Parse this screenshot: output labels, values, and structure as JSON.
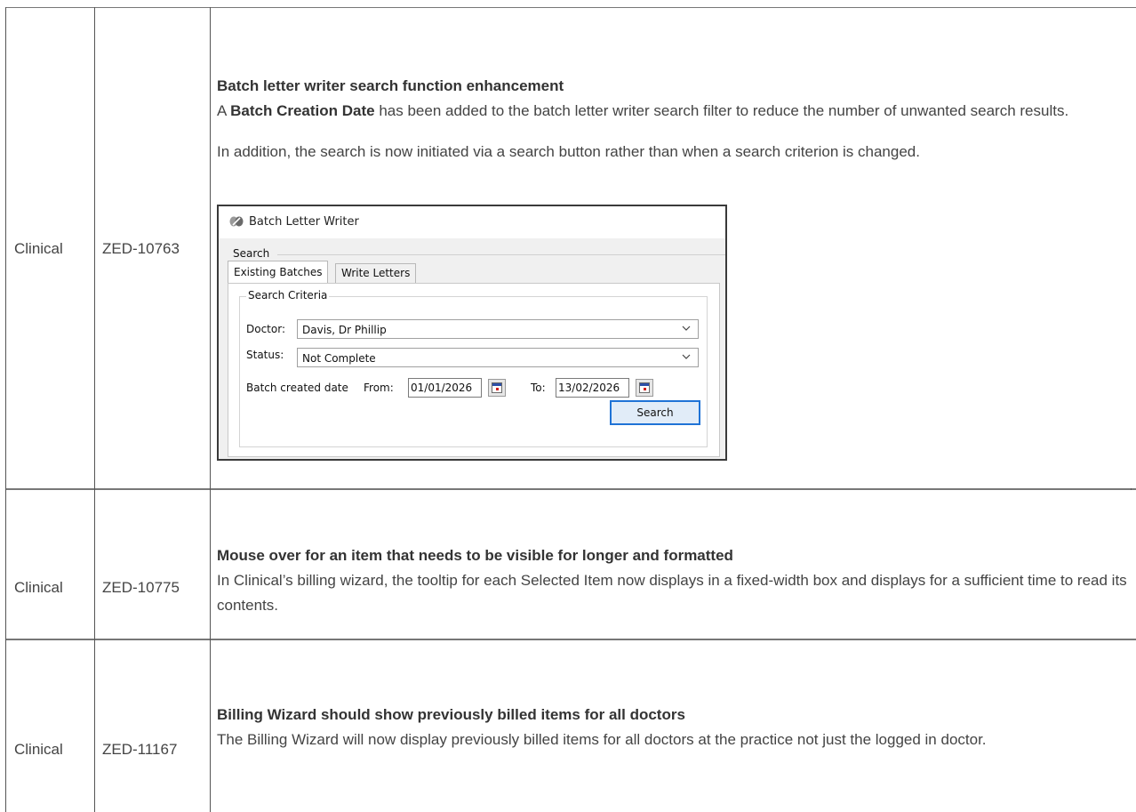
{
  "rows": [
    {
      "category": "Clinical",
      "ticket": "ZED-10763",
      "title": "Batch letter writer search function enhancement",
      "desc_pre": "A ",
      "desc_bold": "Batch Creation Date",
      "desc_post": " has been added to the batch letter writer search filter to reduce the number of unwanted search results.",
      "desc_2": "In addition, the search is now initiated via a search button rather than when a search criterion is changed."
    },
    {
      "category": "Clinical",
      "ticket": "ZED-10775",
      "title": "Mouse over for an item that needs to be visible for longer and formatted",
      "desc": "In Clinical’s billing wizard, the tooltip for each Selected Item now displays in a fixed-width box and displays for a sufficient time to read its contents."
    },
    {
      "category": "Clinical",
      "ticket": "ZED-11167",
      "title": "Billing Wizard should show previously billed items for all doctors",
      "desc": "The Billing Wizard will now display previously billed items for all doctors at the practice not just the logged in doctor."
    }
  ],
  "window": {
    "title": "Batch Letter Writer",
    "group_label": "Search",
    "tabs": [
      "Existing Batches",
      "Write Letters"
    ],
    "criteria_label": "Search Criteria",
    "doctor_label": "Doctor:",
    "doctor_value": "Davis, Dr Phillip",
    "status_label": "Status:",
    "status_value": "Not Complete",
    "batch_created_label": "Batch created date",
    "from_label": "From:",
    "from_value": "01/01/2026",
    "to_label": "To:",
    "to_value": "13/02/2026",
    "search_button": "Search",
    "icons": {
      "logo": "app-logo-icon",
      "dropdown": "chevron-down-icon",
      "calendar": "calendar-icon"
    }
  }
}
